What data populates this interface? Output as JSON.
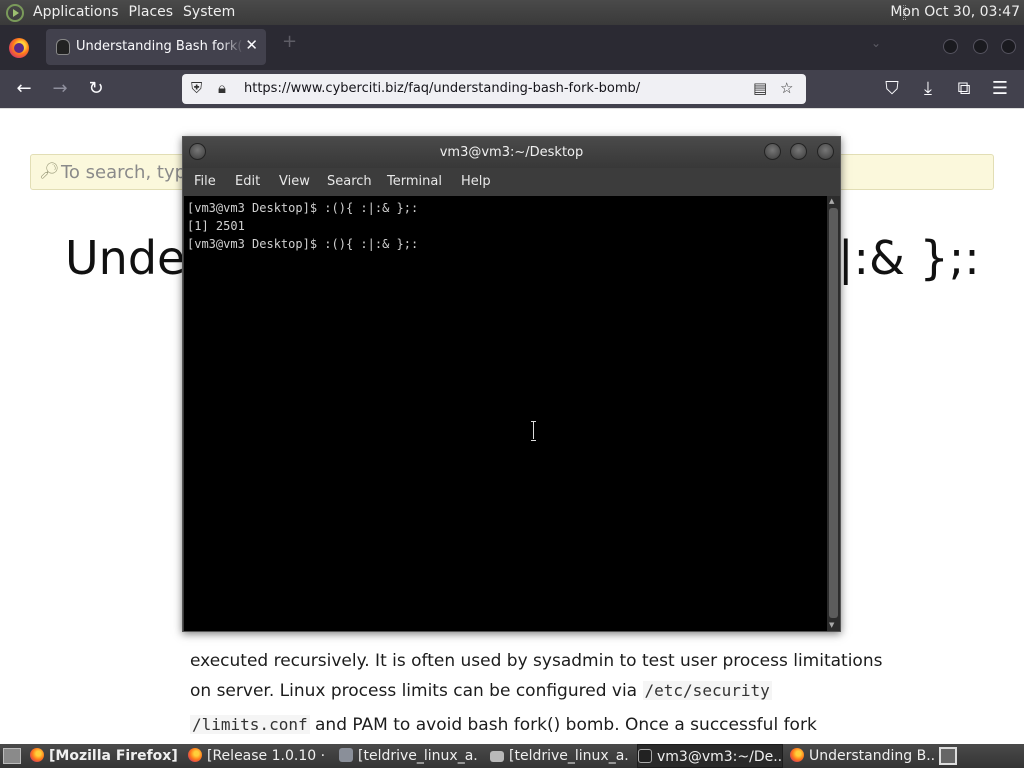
{
  "top_panel": {
    "menus": [
      "Applications",
      "Places",
      "System"
    ],
    "clock": "Mon Oct 30, 03:47"
  },
  "firefox": {
    "tab_title": "Understanding Bash fork() Bomb ~ :(){ :|:& };:",
    "tab_close": "✕",
    "new_tab": "+",
    "list_tabs": "⌄",
    "url": "https://www.cyberciti.biz/faq/understanding-bash-fork-bomb/",
    "nav_icons": {
      "back": "←",
      "forward": "→",
      "reload": "↻",
      "reader": "▤",
      "bookmark": "☆",
      "pocket": "⛉",
      "downloads": "⤓",
      "extensions": "⧉",
      "menu": "☰"
    }
  },
  "page": {
    "search_placeholder": "To search, type",
    "heading_left": "Under",
    "heading_right": "|:& };:",
    "para_line1": "executed recursively. It is often used by sysadmin to test user process limitations",
    "para_line2_text": "on server. Linux process limits can be configured via",
    "para_line2_code": "/etc/security",
    "para_line3_code": "/limits.conf",
    "para_line3_text": "and PAM to avoid bash fork() bomb. Once a successful fork"
  },
  "terminal": {
    "title": "vm3@vm3:~/Desktop",
    "menu": [
      "File",
      "Edit",
      "View",
      "Search",
      "Terminal",
      "Help"
    ],
    "lines": [
      "[vm3@vm3 Desktop]$ :(){ :|:& };:",
      "[1] 2501",
      "[vm3@vm3 Desktop]$ :(){ :|:& };:"
    ]
  },
  "taskbar": {
    "items": [
      {
        "label": "[Mozilla Firefox]",
        "icon": "firefox-icon"
      },
      {
        "label": "[Release 1.0.10 · ...",
        "icon": "firefox-icon"
      },
      {
        "label": "[teldrive_linux_a...",
        "icon": "document-icon"
      },
      {
        "label": "[teldrive_linux_a...",
        "icon": "folder-icon"
      },
      {
        "label": "vm3@vm3:~/De...",
        "icon": "terminal-icon"
      },
      {
        "label": "Understanding B...",
        "icon": "firefox-icon"
      }
    ]
  }
}
